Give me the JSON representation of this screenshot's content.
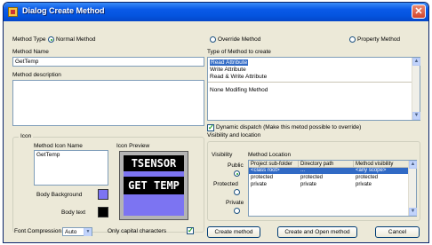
{
  "window": {
    "title": "Dialog Create Method",
    "close_glyph": "✕"
  },
  "method_type": {
    "label": "Method Type",
    "options": [
      {
        "label": "Normal Method",
        "selected": true
      },
      {
        "label": "Override Method",
        "selected": false
      },
      {
        "label": "Property Method",
        "selected": false
      }
    ]
  },
  "method_name": {
    "label": "Method Name",
    "value": "GetTemp"
  },
  "method_description": {
    "label": "Method description",
    "value": ""
  },
  "type_to_create": {
    "label": "Type of Method to create",
    "items": [
      "Read Attribute",
      "Write Attribute",
      "Read & Write Attribute",
      "None Modifing Method"
    ],
    "selected_index": 0
  },
  "dynamic_dispatch": {
    "label": "Dynamic dispatch (Make this metod possible to override)",
    "checked": true
  },
  "icon": {
    "group_label": "Icon",
    "name_label": "Method Icon Name",
    "name_value": "GetTemp",
    "preview_label": "Icon Preview",
    "preview_top_text": "TSENSOR",
    "preview_main_text": "GET TEMP",
    "body_background_label": "Body Background",
    "body_background_color": "#7c74f2",
    "body_text_label": "Body text",
    "body_text_color": "#000000",
    "font_compression_label": "Font Compression",
    "font_compression_value": "Auto",
    "only_capital_label": "Only capital characters",
    "only_capital_checked": true
  },
  "visibility": {
    "group_label": "Visibility and location",
    "visibility_label": "Visibility",
    "options": [
      {
        "label": "Public",
        "selected": true
      },
      {
        "label": "Protected",
        "selected": false
      },
      {
        "label": "Private",
        "selected": false
      }
    ],
    "location_label": "Method Location",
    "columns": [
      "Project sub-folder",
      "Directory path",
      "Method visibility"
    ],
    "rows": [
      [
        "<class root>",
        "...",
        "<any scope>"
      ],
      [
        "protected",
        "protected",
        "protected"
      ],
      [
        "private",
        "private",
        "private"
      ]
    ],
    "selected_row": 0
  },
  "buttons": {
    "create": "Create method",
    "create_open": "Create and Open method",
    "cancel": "Cancel"
  },
  "colors": {
    "title_bar": "#0454df",
    "dialog_bg": "#ece9d8",
    "selection": "#316ac5"
  }
}
